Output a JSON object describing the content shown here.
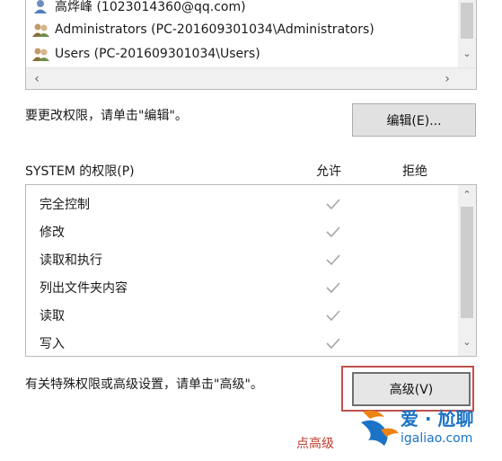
{
  "users_list": {
    "items": [
      {
        "name": "高烨峰 (1023014360@qq.com)",
        "icon": "user-icon"
      },
      {
        "name": "Administrators (PC-201609301034\\Administrators)",
        "icon": "group-icon"
      },
      {
        "name": "Users (PC-201609301034\\Users)",
        "icon": "group-icon"
      }
    ]
  },
  "edit_hint": "要更改权限，请单击\"编辑\"。",
  "edit_button": "编辑(E)...",
  "permissions": {
    "header": "SYSTEM 的权限(P)",
    "allow_header": "允许",
    "deny_header": "拒绝",
    "rows": [
      {
        "label": "完全控制",
        "allow": true,
        "deny": false
      },
      {
        "label": "修改",
        "allow": true,
        "deny": false
      },
      {
        "label": "读取和执行",
        "allow": true,
        "deny": false
      },
      {
        "label": "列出文件夹内容",
        "allow": true,
        "deny": false
      },
      {
        "label": "读取",
        "allow": true,
        "deny": false
      },
      {
        "label": "写入",
        "allow": true,
        "deny": false
      }
    ]
  },
  "advanced_hint": "有关特殊权限或高级设置，请单击\"高级\"。",
  "advanced_button": "高级(V)",
  "annotation": "点高级",
  "watermark": {
    "title": "爱 · 尬聊",
    "url": "igaliao.com"
  },
  "colors": {
    "highlight": "#c0504d",
    "annotation": "#c0392b",
    "watermark": "#1a73c7",
    "watermark_accent": "#f0820f",
    "check": "#a6a6a6"
  }
}
